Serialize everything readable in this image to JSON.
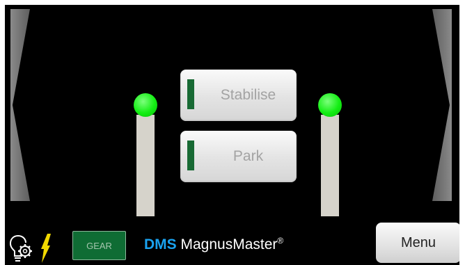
{
  "buttons": {
    "stabilise_label": "Stabilise",
    "park_label": "Park",
    "gear_label": "GEAR",
    "menu_label": "Menu"
  },
  "brand": {
    "prefix": "DMS",
    "name": " MagnusMaster",
    "registered": "®"
  },
  "icons": {
    "left_arrow": "left-arrow-icon",
    "right_arrow": "right-arrow-icon",
    "bulb_gear": "bulb-gear-icon",
    "bolt": "lightning-bolt-icon"
  },
  "indicators": {
    "left_status": "on",
    "right_status": "on"
  },
  "colors": {
    "background": "#000000",
    "status_led": "#14ee14",
    "button_indicator": "#186a34",
    "gear_button": "#0f6c34",
    "brand_accent": "#1aa3f0",
    "bolt": "#f2d900",
    "arrow": "#7a7a7a"
  }
}
